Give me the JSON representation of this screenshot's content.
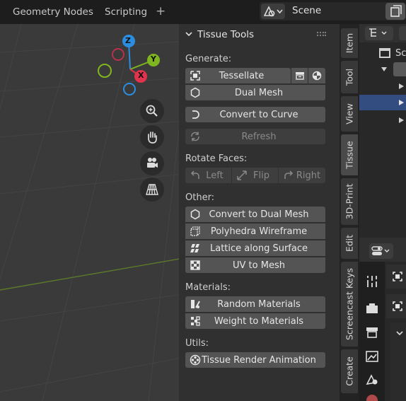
{
  "topbar": {
    "workspaces": [
      "Geometry Nodes",
      "Scripting"
    ],
    "add_workspace": "+",
    "scene_name": "Scene"
  },
  "gizmo": {
    "x": "X",
    "y": "Y",
    "z": "Z"
  },
  "panel": {
    "title": "Tissue Tools",
    "generate_label": "Generate:",
    "tessellate": "Tessellate",
    "dual_mesh": "Dual Mesh",
    "convert_to_curve": "Convert to Curve",
    "refresh": "Refresh",
    "rotate_faces_label": "Rotate Faces:",
    "left": "Left",
    "flip": "Flip",
    "right": "Right",
    "other_label": "Other:",
    "convert_to_dual_mesh": "Convert to Dual Mesh",
    "polyhedra_wireframe": "Polyhedra Wireframe",
    "lattice_along_surface": "Lattice along Surface",
    "uv_to_mesh": "UV to Mesh",
    "materials_label": "Materials:",
    "random_materials": "Random Materials",
    "weight_to_materials": "Weight to Materials",
    "utils_label": "Utils:",
    "tissue_render_animation": "Tissue Render Animation"
  },
  "side_tabs": [
    "Item",
    "Tool",
    "View",
    "Tissue",
    "3D-Print",
    "Edit",
    "Screencast Keys",
    "Create"
  ],
  "active_tab": "Tissue",
  "outliner": {
    "scene_label": "Sc"
  },
  "colors": {
    "x_axis": "#e0334d",
    "y_axis": "#7fb51f",
    "z_axis": "#2b8de0",
    "selection": "#334d80",
    "button": "#545454"
  }
}
